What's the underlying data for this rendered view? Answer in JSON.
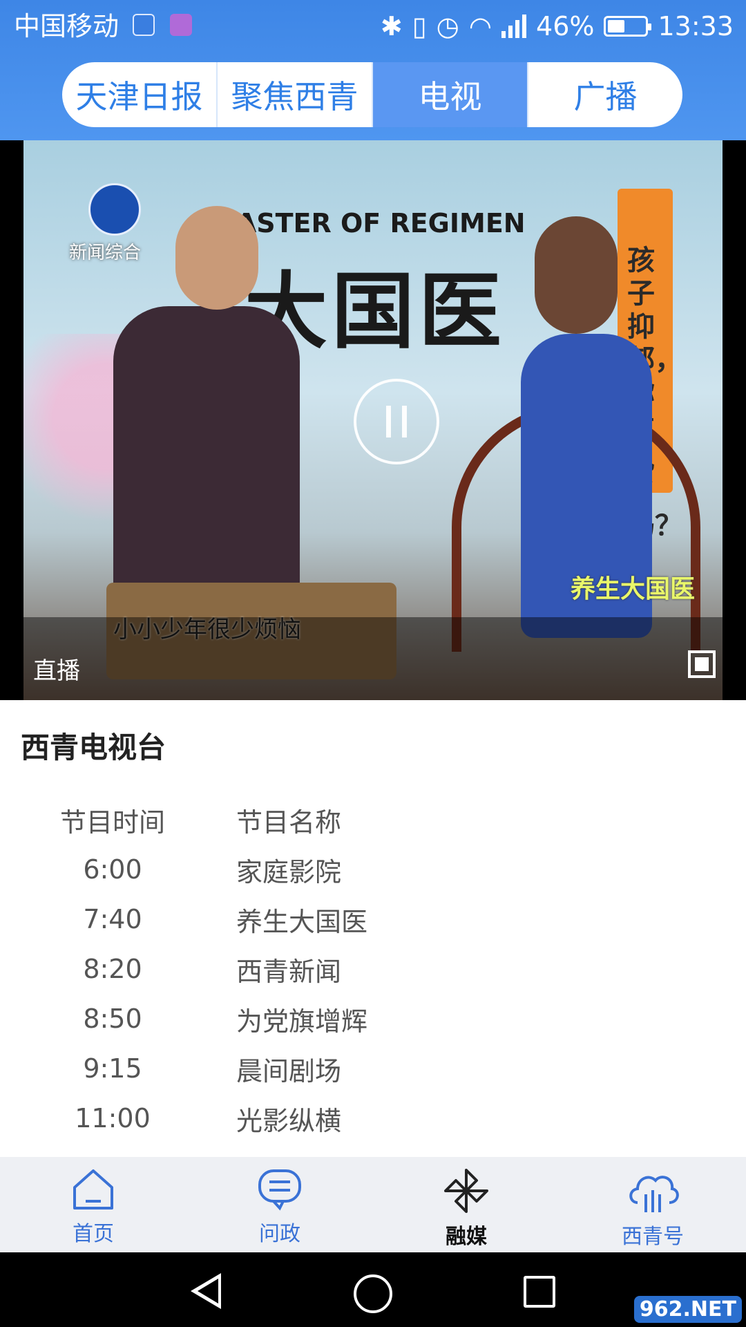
{
  "status_bar": {
    "carrier": "中国移动",
    "network": "2G",
    "battery": "46%",
    "battery_level": 0.46,
    "time": "13:33"
  },
  "tabs": [
    {
      "label": "天津日报",
      "active": false
    },
    {
      "label": "聚焦西青",
      "active": false
    },
    {
      "label": "电视",
      "active": true
    },
    {
      "label": "广播",
      "active": false
    }
  ],
  "video": {
    "channel_logo_text": "新闻综合",
    "show_en": "MASTER OF REGIMEN",
    "show_zh": "大国医",
    "side_text": "孩子抑郁，你发现了吗？",
    "subtitle": "小小少年很少烦恼",
    "corner_logo_text": "养生大国医",
    "live_label": "直播"
  },
  "channel": {
    "title": "西青电视台"
  },
  "schedule": {
    "header": {
      "time": "节目时间",
      "name": "节目名称"
    },
    "rows": [
      {
        "time": "6:00",
        "name": "家庭影院"
      },
      {
        "time": "7:40",
        "name": "养生大国医"
      },
      {
        "time": "8:20",
        "name": "西青新闻"
      },
      {
        "time": "8:50",
        "name": "为党旗增辉"
      },
      {
        "time": "9:15",
        "name": "晨间剧场"
      },
      {
        "time": "11:00",
        "name": "光影纵横"
      }
    ]
  },
  "bottom_nav": [
    {
      "label": "首页",
      "icon": "home-icon",
      "active": false
    },
    {
      "label": "问政",
      "icon": "chat-bubble-icon",
      "active": false
    },
    {
      "label": "融媒",
      "icon": "pinwheel-icon",
      "active": true
    },
    {
      "label": "西青号",
      "icon": "cloud-icon",
      "active": false
    }
  ],
  "watermark": "962.NET",
  "colors": {
    "header_blue": "#4f96f0",
    "tab_active": "#5a97f2",
    "tab_text": "#2f7fe6",
    "nav_text": "#3a72d6"
  }
}
